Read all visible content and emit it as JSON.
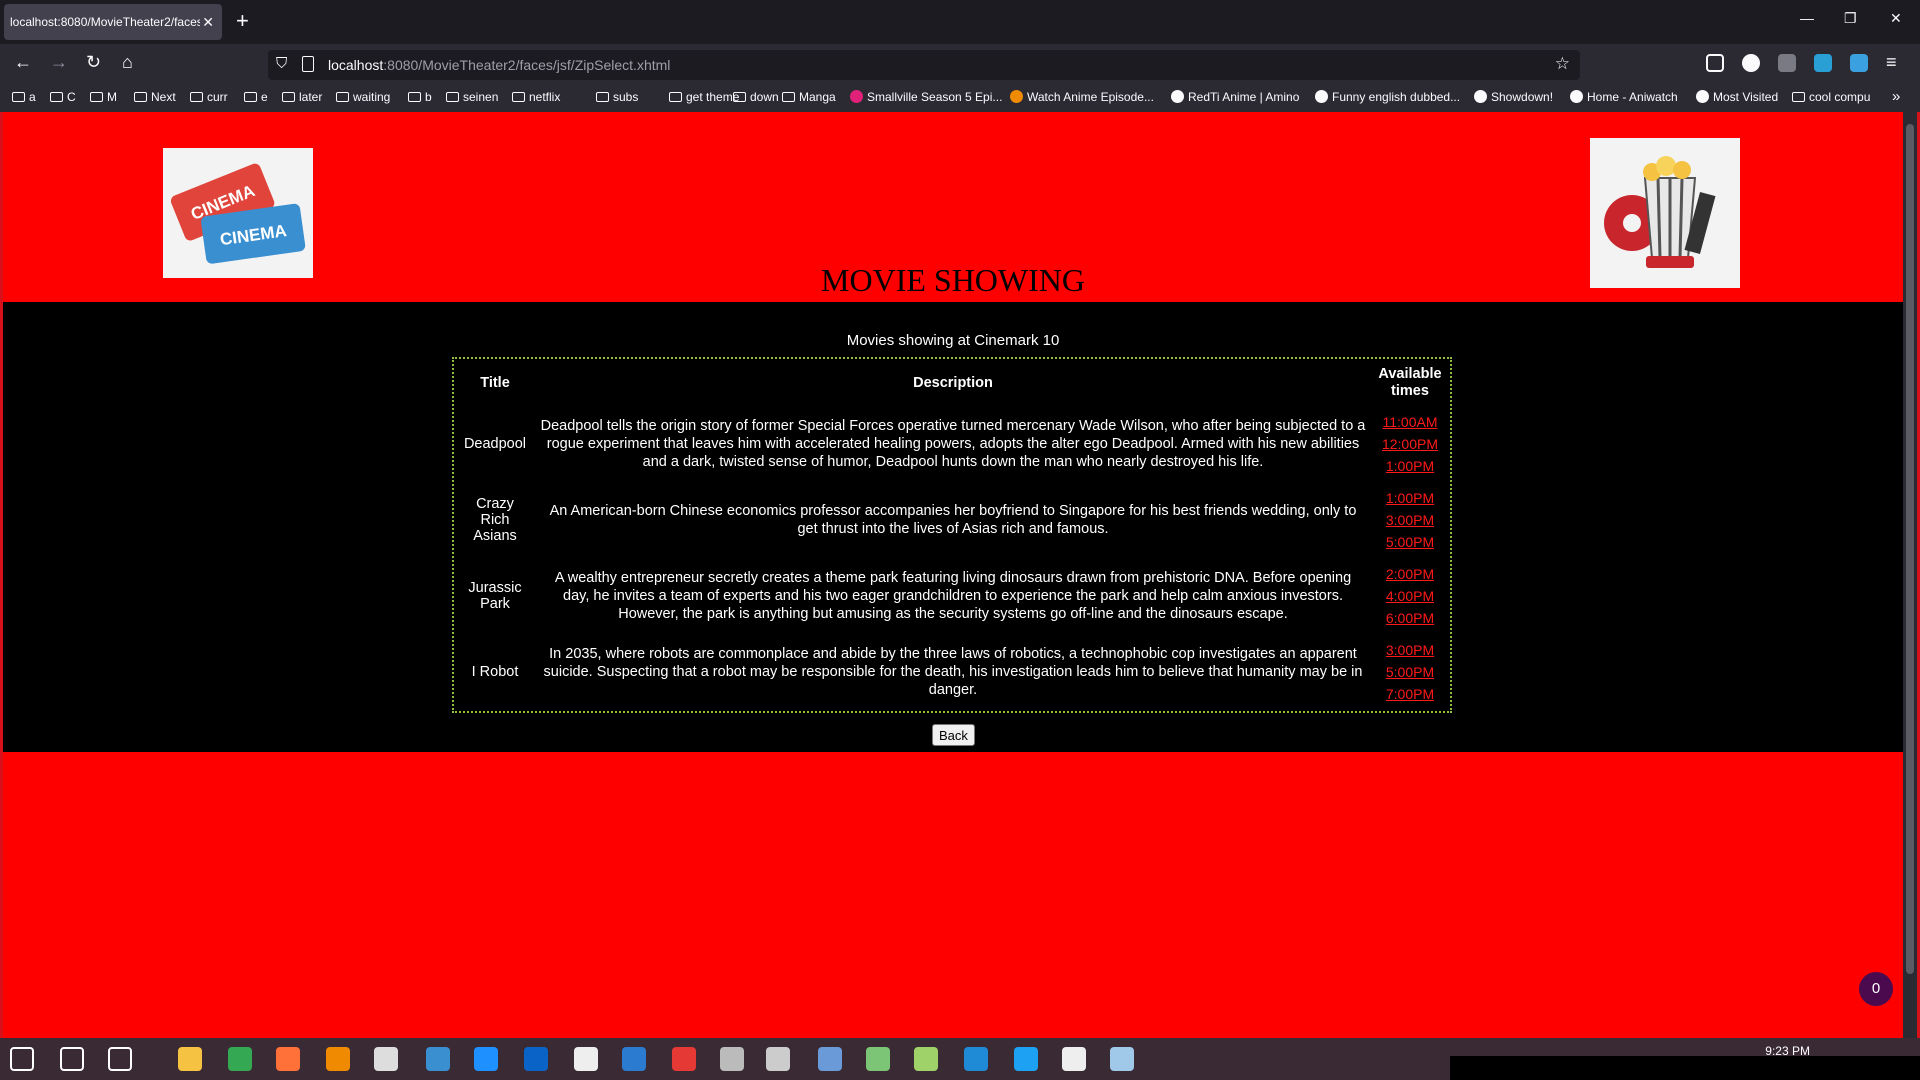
{
  "browser": {
    "tab_title": "localhost:8080/MovieTheater2/faces/",
    "tab_close": "✕",
    "new_tab": "+",
    "url_host": "localhost",
    "url_rest": ":8080/MovieTheater2/faces/jsf/ZipSelect.xhtml",
    "minimize": "—",
    "restore": "❐",
    "close": "✕",
    "back": "←",
    "forward": "→",
    "reload": "↻",
    "home": "⌂",
    "bookmarks": [
      {
        "label": "a",
        "type": "folder"
      },
      {
        "label": "C",
        "type": "folder"
      },
      {
        "label": "M",
        "type": "folder"
      },
      {
        "label": "Next",
        "type": "folder"
      },
      {
        "label": "curr",
        "type": "folder"
      },
      {
        "label": "e",
        "type": "folder"
      },
      {
        "label": "later",
        "type": "folder"
      },
      {
        "label": "waiting",
        "type": "folder"
      },
      {
        "label": "b",
        "type": "folder"
      },
      {
        "label": "seinen",
        "type": "folder"
      },
      {
        "label": "netflix",
        "type": "folder"
      },
      {
        "label": "subs",
        "type": "folder"
      },
      {
        "label": "get theme",
        "type": "folder"
      },
      {
        "label": "down",
        "type": "folder"
      },
      {
        "label": "Manga",
        "type": "folder"
      },
      {
        "label": "Smallville Season 5 Epi...",
        "type": "site",
        "color": "#e0217a"
      },
      {
        "label": "Watch Anime Episode...",
        "type": "site",
        "color": "#f08a00"
      },
      {
        "label": "RedTi Anime | Amino",
        "type": "site",
        "color": "#fbfbfe"
      },
      {
        "label": "Funny english dubbed...",
        "type": "site",
        "color": "#fbfbfe"
      },
      {
        "label": "Showdown!",
        "type": "site",
        "color": "#fbfbfe"
      },
      {
        "label": "Home - Aniwatch",
        "type": "site",
        "color": "#fbfbfe"
      },
      {
        "label": "Most Visited",
        "type": "site",
        "color": "#fbfbfe"
      },
      {
        "label": "cool compu",
        "type": "folder"
      }
    ],
    "overflow": "»"
  },
  "page": {
    "heading": "MOVIE SHOWING",
    "subtitle": "Movies showing at Cinemark 10",
    "table_headers": {
      "title": "Title",
      "description": "Description",
      "times": "Available times"
    },
    "movies": [
      {
        "title": "Deadpool",
        "description": "Deadpool tells the origin story of former Special Forces operative turned mercenary Wade Wilson, who after being subjected to a rogue experiment that leaves him with accelerated healing powers, adopts the alter ego Deadpool. Armed with his new abilities and a dark, twisted sense of humor, Deadpool hunts down the man who nearly destroyed his life.",
        "times": [
          "11:00AM",
          "12:00PM",
          "1:00PM"
        ]
      },
      {
        "title": "Crazy Rich Asians",
        "description": "An American-born Chinese economics professor accompanies her boyfriend to Singapore for his best friends wedding, only to get thrust into the lives of Asias rich and famous.",
        "times": [
          "1:00PM",
          "3:00PM",
          "5:00PM"
        ]
      },
      {
        "title": "Jurassic Park",
        "description": "A wealthy entrepreneur secretly creates a theme park featuring living dinosaurs drawn from prehistoric DNA. Before opening day, he invites a team of experts and his two eager grandchildren to experience the park and help calm anxious investors. However, the park is anything but amusing as the security systems go off-line and the dinosaurs escape.",
        "times": [
          "2:00PM",
          "4:00PM",
          "6:00PM"
        ]
      },
      {
        "title": "I Robot",
        "description": "In 2035, where robots are commonplace and abide by the three laws of robotics, a technophobic cop investigates an apparent suicide. Suspecting that a robot may be responsible for the death, his investigation leads him to believe that humanity may be in danger.",
        "times": [
          "3:00PM",
          "5:00PM",
          "7:00PM"
        ]
      }
    ],
    "back_button": "Back",
    "badge_count": "0"
  },
  "taskbar": {
    "clock": "9:23 PM",
    "apps": [
      "start-icon",
      "search-icon",
      "task-view-icon",
      "file-explorer-icon",
      "chrome-icon",
      "firefox-icon",
      "vlc-icon",
      "app-icon",
      "todo-icon",
      "mail-icon",
      "outlook-icon",
      "paint-icon",
      "terminal-icon",
      "youtube-icon",
      "settings-wheel-icon",
      "photos-icon",
      "qbittorrent-icon",
      "notepad-icon",
      "package-icon",
      "vscode-icon",
      "skype-icon",
      "gear-icon",
      "notes-icon"
    ]
  }
}
